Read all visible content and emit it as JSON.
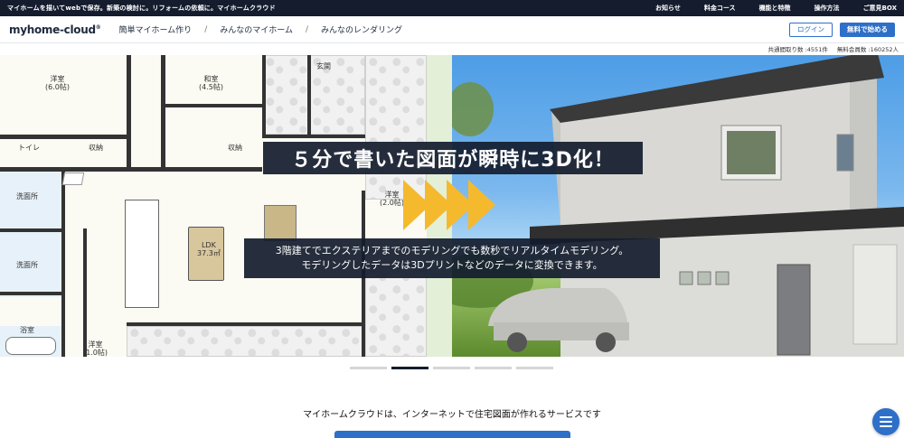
{
  "topbar": {
    "tagline": "マイホームを描いてwebで保存。新築の検討に。リフォームの依頼に。マイホームクラウド",
    "links": [
      "お知らせ",
      "料金コース",
      "機能と特徴",
      "操作方法",
      "ご意見BOX"
    ]
  },
  "nav": {
    "logo": "myhome-cloud",
    "links": [
      "簡単マイホーム作り",
      "みんなのマイホーム",
      "みんなのレンダリング"
    ],
    "separator": "/",
    "login": "ログイン",
    "start": "無料で始める"
  },
  "counts": {
    "floorplans": "共通間取り数 :4551件",
    "members": "無料会員数 :160252人"
  },
  "plan_labels": {
    "room1": "洋室\n(6.0帖)",
    "room2": "和室\n(4.5帖)",
    "genkan": "玄関",
    "toilet": "トイレ",
    "storage1": "収納",
    "storage2": "収納",
    "washroom1": "洗面所",
    "washroom2": "洗面所",
    "room3": "洋室\n(2.0帖)",
    "ldk": "LDK\n37.3㎡",
    "bath": "浴室",
    "room4": "洋室\n(1.0帖)"
  },
  "hero": {
    "headline": "５分で書いた図面が瞬時に3D化！",
    "sub_line1": "3階建てでエクステリアまでのモデリングでも数秒でリアルタイムモデリング。",
    "sub_line2": "モデリングしたデータは3Dプリントなどのデータに変換できます。"
  },
  "carousel": {
    "count": 5,
    "active": 1
  },
  "intro": "マイホームクラウドは、インターネットで住宅図面が作れるサービスです",
  "colors": {
    "navy": "#141c2e",
    "accent": "#2e6fc8",
    "arrow": "#f5b92e"
  }
}
